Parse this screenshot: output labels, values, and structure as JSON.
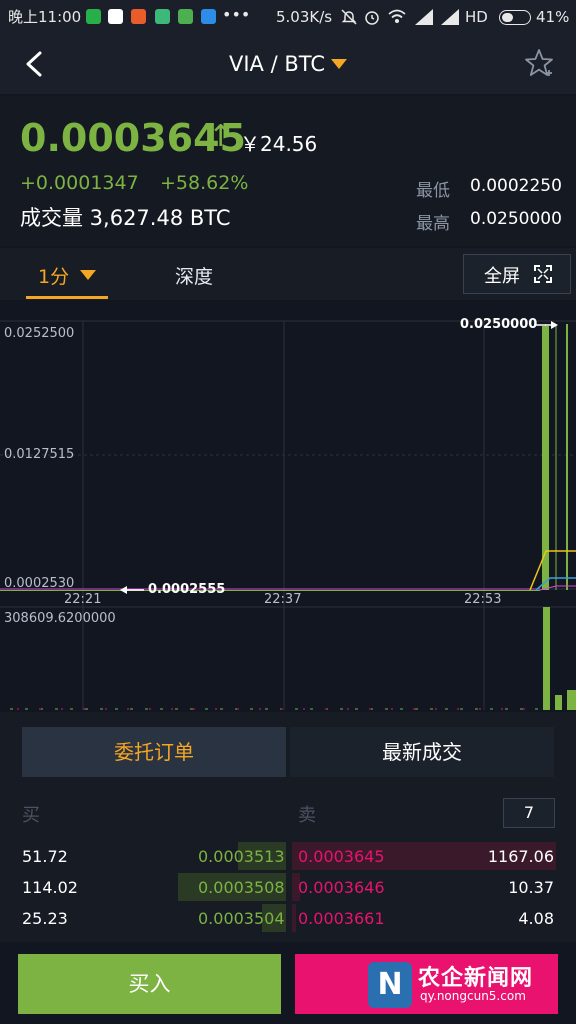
{
  "status": {
    "time": "晚上11:00",
    "dots": "•••",
    "speed": "5.03K/s",
    "network": "HD",
    "battery": "41%"
  },
  "nav": {
    "pair": "VIA / BTC"
  },
  "ticker": {
    "price": "0.0003645",
    "arrow": "↑",
    "cny": "￥24.56",
    "change": "+0.0001347",
    "change_pct": "+58.62%",
    "volume": "成交量 3,627.48 BTC",
    "low_label": "最低",
    "low_value": "0.0002250",
    "high_label": "最高",
    "high_value": "0.0250000"
  },
  "tabs": {
    "interval": "1分",
    "depth": "深度",
    "fullscreen": "全屏"
  },
  "chart_data": {
    "type": "line",
    "y_ticks": [
      "0.0252500",
      "0.0127515",
      "0.0002530"
    ],
    "x_ticks": [
      "22:21",
      "22:37",
      "22:53"
    ],
    "max_label": "0.0250000",
    "min_label": "0.0002555",
    "volume_label": "308609.6200000",
    "colors": {
      "up": "#7cb342",
      "down": "#e9126e",
      "ma1": "#f0c419",
      "ma2": "#3aa0d8",
      "ma3": "#d64ad8"
    }
  },
  "book": {
    "tab_orders": "委托订单",
    "tab_trades": "最新成交",
    "buy_label": "买",
    "sell_label": "卖",
    "depth": "7",
    "rows": [
      {
        "bid_qty": "51.72",
        "bid_price": "0.0003513",
        "ask_price": "0.0003645",
        "ask_qty": "1167.06"
      },
      {
        "bid_qty": "114.02",
        "bid_price": "0.0003508",
        "ask_price": "0.0003646",
        "ask_qty": "10.37"
      },
      {
        "bid_qty": "25.23",
        "bid_price": "0.0003504",
        "ask_price": "0.0003661",
        "ask_qty": "4.08"
      }
    ]
  },
  "actions": {
    "buy": "买入"
  },
  "watermark": "农企新闻网 qy.nongcun5.com"
}
